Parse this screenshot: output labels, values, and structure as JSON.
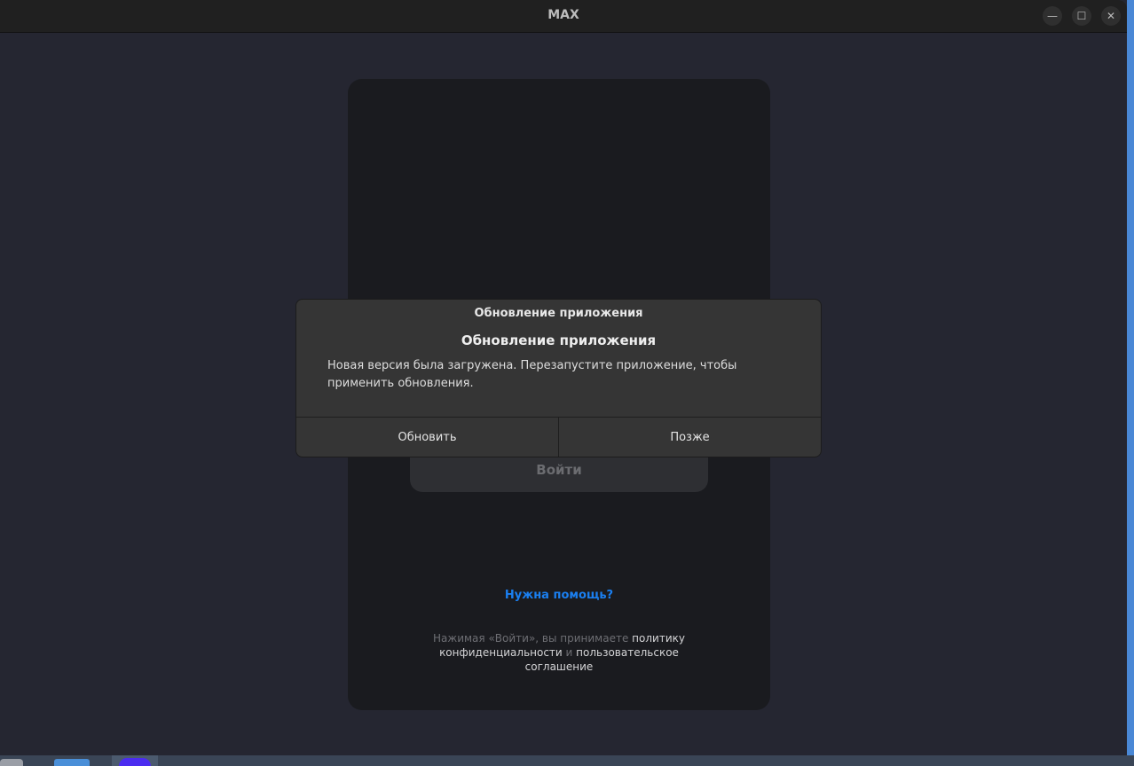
{
  "window": {
    "title": "MAX",
    "minimize_icon": "—",
    "maximize_icon": "☐",
    "close_icon": "✕"
  },
  "login": {
    "button": "Войти",
    "help_link": "Нужна помощь?",
    "terms_prefix": "Нажимая «Войти», вы принимаете ",
    "terms_privacy": "политику конфиденциальности",
    "terms_and": " и ",
    "terms_agreement": "пользовательское соглашение"
  },
  "dialog": {
    "window_title": "Обновление приложения",
    "title": "Обновление приложения",
    "message": "Новая версия была загружена. Перезапустите приложение, чтобы применить обновления.",
    "update_button": "Обновить",
    "later_button": "Позже"
  },
  "colors": {
    "accent": "#1a7ff0"
  }
}
